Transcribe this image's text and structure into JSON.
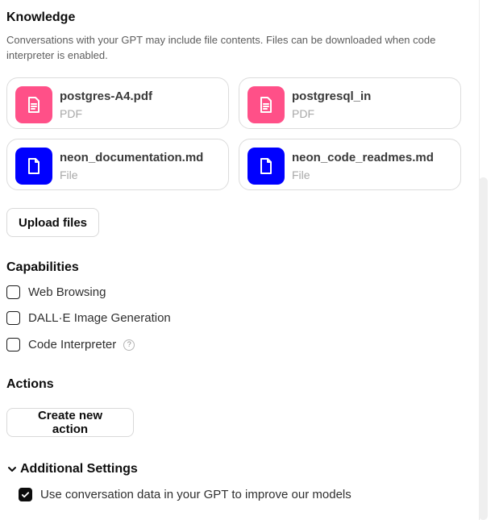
{
  "knowledge": {
    "title": "Knowledge",
    "description": "Conversations with your GPT may include file contents. Files can be downloaded when code interpreter is enabled.",
    "files": [
      {
        "name": "postgres-A4.pdf",
        "type": "PDF",
        "icon": "pdf-file-icon",
        "color": "#ff5088"
      },
      {
        "name": "postgresql_in",
        "type": "PDF",
        "icon": "pdf-file-icon",
        "color": "#ff5088"
      },
      {
        "name": "neon_documentation.md",
        "type": "File",
        "icon": "document-icon",
        "color": "#0000ff"
      },
      {
        "name": "neon_code_readmes.md",
        "type": "File",
        "icon": "document-icon",
        "color": "#0000ff"
      }
    ],
    "upload_label": "Upload files"
  },
  "capabilities": {
    "title": "Capabilities",
    "items": [
      {
        "label": "Web Browsing",
        "checked": false
      },
      {
        "label": "DALL·E Image Generation",
        "checked": false
      },
      {
        "label": "Code Interpreter",
        "checked": false,
        "help": "?"
      }
    ]
  },
  "actions": {
    "title": "Actions",
    "create_label": "Create new action"
  },
  "additional": {
    "title": "Additional Settings",
    "expanded": true,
    "option_label": "Use conversation data in your GPT to improve our models",
    "option_checked": true
  }
}
